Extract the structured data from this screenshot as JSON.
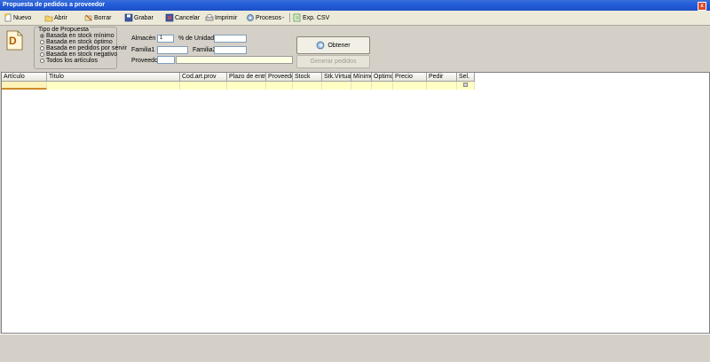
{
  "window": {
    "title": "Propuesta de pedidos a proveedor",
    "close_glyph": "x"
  },
  "toolbar": {
    "items": [
      {
        "label": "Nuevo",
        "icon": "new-document-icon"
      },
      {
        "label": "Abrir",
        "icon": "open-folder-icon"
      },
      {
        "label": "Borrar",
        "icon": "delete-icon"
      },
      {
        "label": "Grabar",
        "icon": "save-disk-icon"
      },
      {
        "label": "Cancelar",
        "icon": "cancel-icon"
      },
      {
        "label": "Imprimir",
        "icon": "printer-icon"
      },
      {
        "label": "Procesos",
        "icon": "process-gear-icon"
      },
      {
        "label": "-",
        "icon": ""
      },
      {
        "label": "Exp. CSV",
        "icon": "export-csv-icon"
      }
    ]
  },
  "tipo": {
    "legend": "Tipo de Propuesta",
    "options": [
      {
        "label": "Basada en stock mínimo",
        "selected": true
      },
      {
        "label": "Basada en stock óptimo",
        "selected": false
      },
      {
        "label": "Basada en pedidos por servir",
        "selected": false
      },
      {
        "label": "Basada en stock negativo",
        "selected": false
      },
      {
        "label": "Todos los artículos",
        "selected": false
      }
    ]
  },
  "filters": {
    "almacen_label": "Almacén",
    "almacen_value": "1",
    "unidades_label": "% de Unidades",
    "unidades_value": "",
    "familia1_label": "Familia1",
    "familia1_value": "",
    "familia2_label": "Familia2",
    "familia2_value": "",
    "proveedor_label": "Proveedor",
    "proveedor_code": "",
    "proveedor_name": ""
  },
  "actions": {
    "obtener": "Obtener",
    "generar": "Generar pedidos"
  },
  "grid": {
    "columns": [
      "Artículo",
      "Titulo",
      "Cod.art.prov",
      "Plazo de entrega",
      "Proveedor",
      "Stock",
      "Stk.Virtual",
      "Mínimo",
      "Óptimo",
      "Precio",
      "Pedir",
      "Sel."
    ]
  },
  "colors": {
    "titlebar": "#245edb",
    "row_highlight": "#ffffc4",
    "selected_cell_border": "#d08b2c"
  }
}
